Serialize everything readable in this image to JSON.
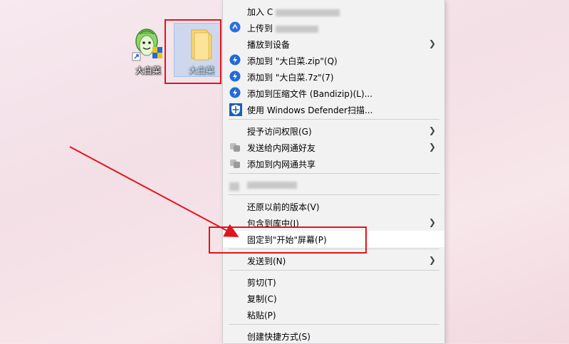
{
  "desktop": {
    "app_icon_label": "大白菜",
    "folder_icon_label": "大白菜"
  },
  "menu": {
    "items": [
      {
        "label": "加入 C"
      },
      {
        "label": "上传到"
      },
      {
        "label": "播放到设备"
      },
      {
        "label": "添加到 \"大白菜.zip\"(Q)"
      },
      {
        "label": "添加到 \"大白菜.7z\"(7)"
      },
      {
        "label": "添加到压缩文件 (Bandizip)(L)..."
      },
      {
        "label": "使用 Windows Defender扫描..."
      },
      {
        "label": "授予访问权限(G)"
      },
      {
        "label": "发送给内网通好友"
      },
      {
        "label": "添加到内网通共享"
      },
      {
        "label": ""
      },
      {
        "label": "还原以前的版本(V)"
      },
      {
        "label": "包含到库中(I)"
      },
      {
        "label": "固定到\"开始\"屏幕(P)"
      },
      {
        "label": "发送到(N)"
      },
      {
        "label": "剪切(T)"
      },
      {
        "label": "复制(C)"
      },
      {
        "label": "粘贴(P)"
      },
      {
        "label": "创建快捷方式(S)"
      }
    ]
  },
  "colors": {
    "highlight_box": "#e0141c",
    "arrow": "#e0141c",
    "menu_bg": "#f2f2f2"
  }
}
